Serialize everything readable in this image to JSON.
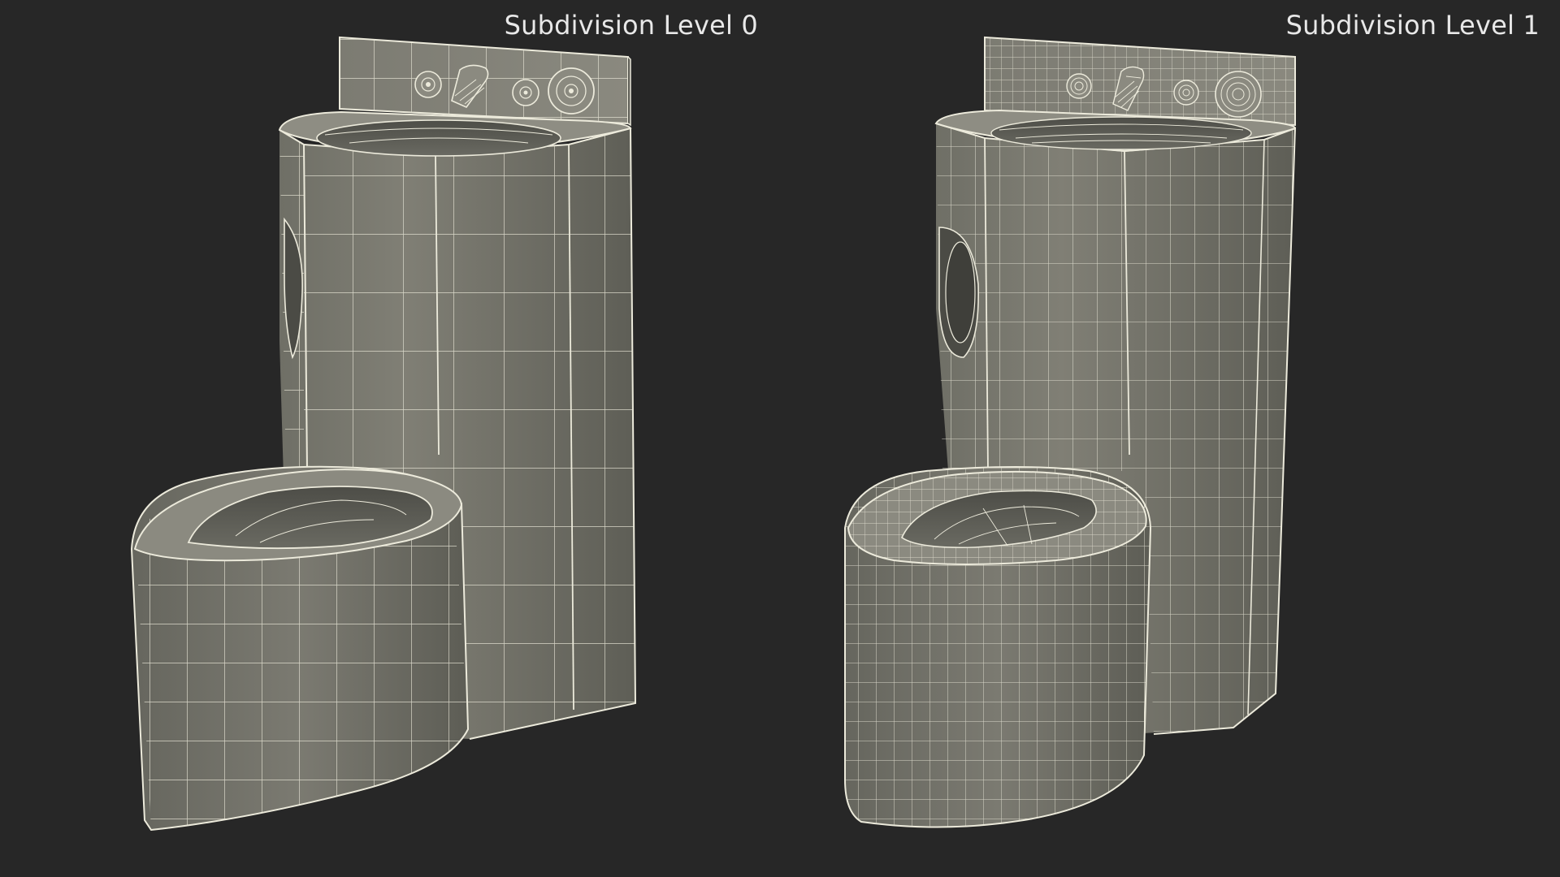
{
  "scene": {
    "background_color": "#272727",
    "mesh_fill_color": "#7a7a70",
    "wire_color": "#eceadb"
  },
  "panels": [
    {
      "label": "Subdivision Level 0",
      "subdivision_level": 0
    },
    {
      "label": "Subdivision Level 1",
      "subdivision_level": 1
    }
  ]
}
